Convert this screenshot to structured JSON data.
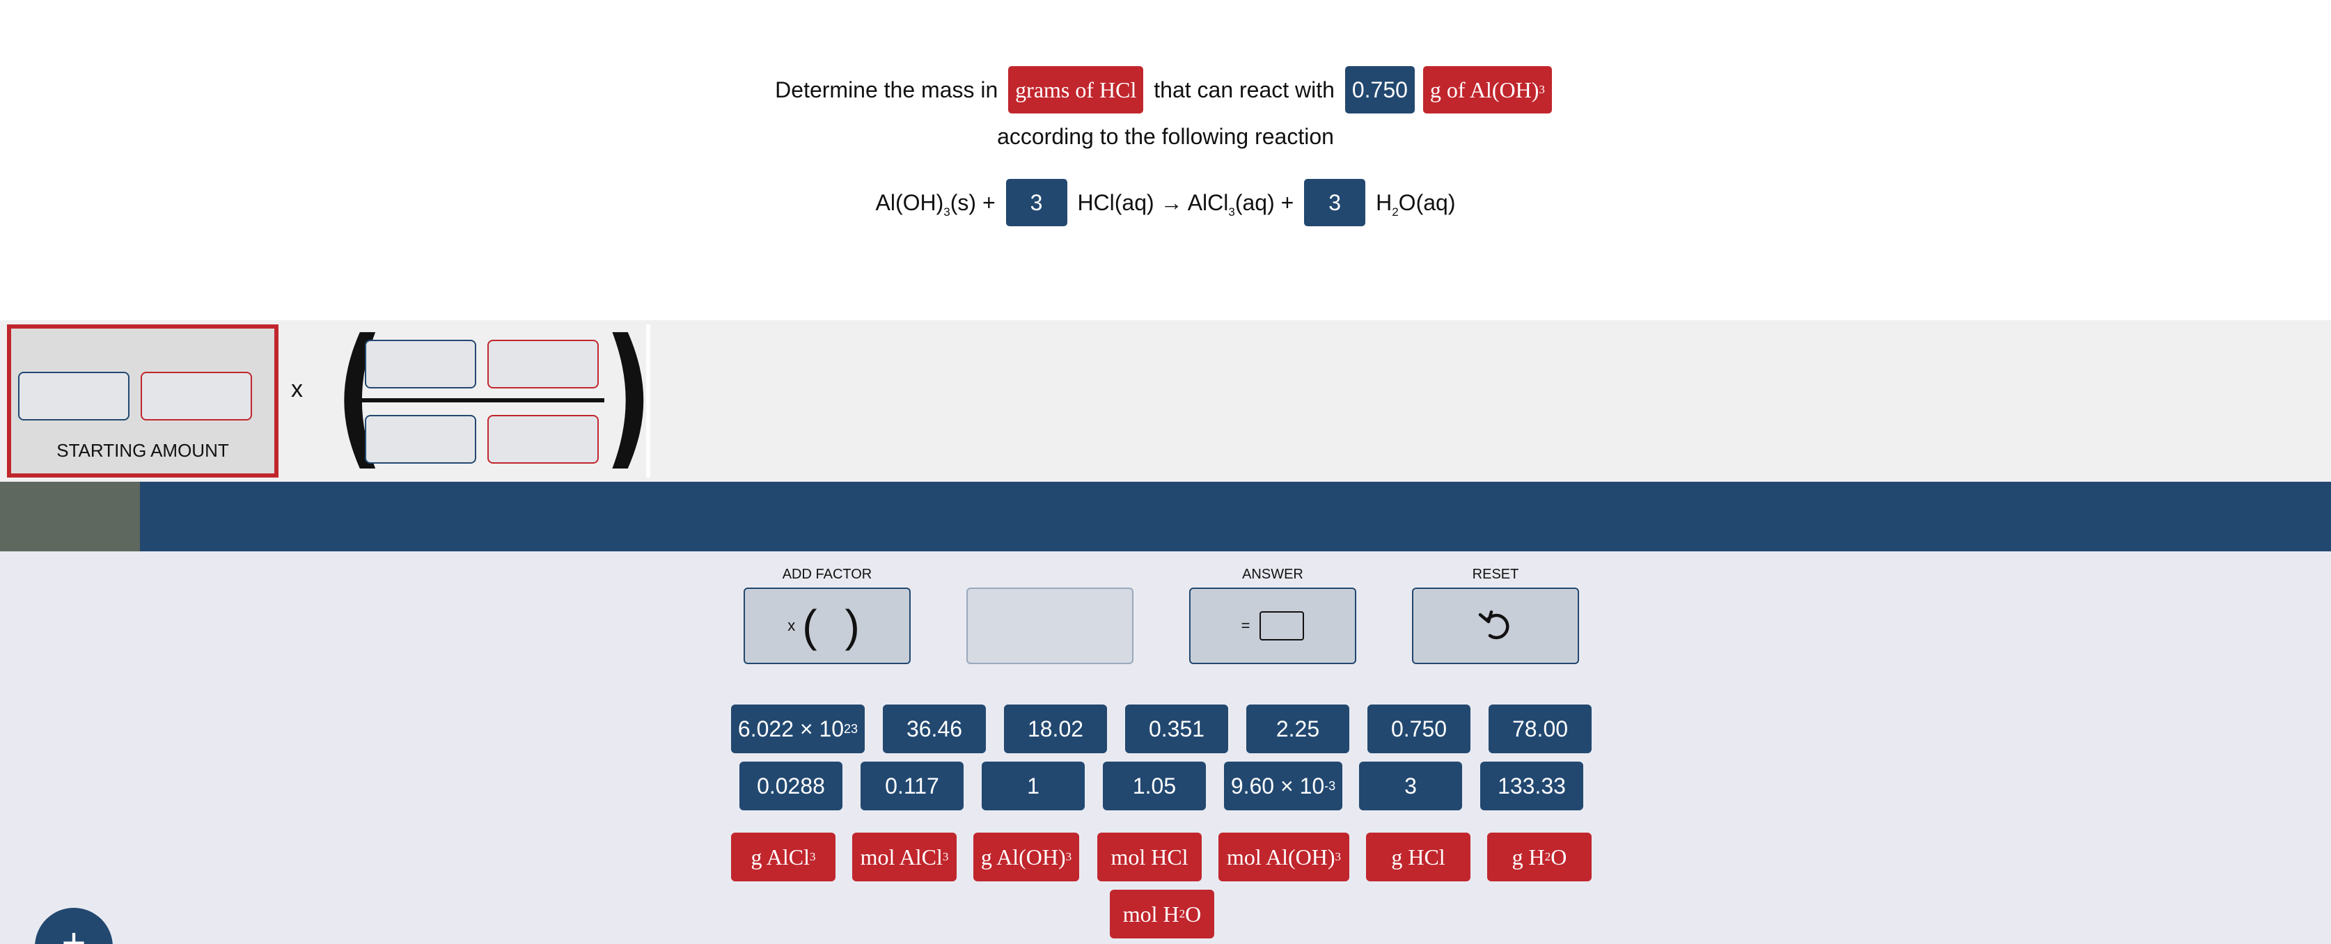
{
  "question": {
    "line1": {
      "prefix": "Determine the mass in ",
      "target_unit": "grams of HCl",
      "middle": " that can react with ",
      "given_value": "0.750",
      "given_unit_main": "g of Al(OH)",
      "given_unit_sub": "3"
    },
    "line2": "according to the following reaction",
    "reaction": {
      "r1_a": "Al(OH)",
      "r1_sub": "3",
      "r1_b": "(s) + ",
      "coef1": "3",
      "r2": " HCl(aq) → AlCl",
      "p1_sub": "3",
      "p1_b": "(aq) + ",
      "coef2": "3",
      "p2_a": " H",
      "p2_sub": "2",
      "p2_b": "O(aq)"
    }
  },
  "workspace": {
    "starting_amount_label": "STARTING AMOUNT",
    "times_symbol": "x",
    "left_paren": "(",
    "right_paren": ")"
  },
  "progress": {
    "fraction": 0.06
  },
  "controls": {
    "add_factor_label": "ADD FACTOR",
    "add_factor_x": "x",
    "add_factor_lparen": "(",
    "add_factor_rparen": ")",
    "answer_label": "ANSWER",
    "answer_equals": "=",
    "reset_label": "RESET",
    "reset_icon": "undo-arrow-icon"
  },
  "number_tiles": {
    "avogadro": {
      "base": "6.022 × 10",
      "exp": "23"
    },
    "row1": [
      "36.46",
      "18.02",
      "0.351",
      "2.25",
      "0.750",
      "78.00"
    ],
    "row2a": [
      "0.0288",
      "0.117",
      "1",
      "1.05"
    ],
    "sci": {
      "base": "9.60 × 10",
      "exp": "-3"
    },
    "row2b": [
      "3",
      "133.33"
    ]
  },
  "unit_tiles": {
    "g_alcl3": {
      "main": "g AlCl",
      "sub": "3"
    },
    "mol_alcl3": {
      "main": "mol AlCl",
      "sub": "3"
    },
    "g_aloh3": {
      "main": "g Al(OH)",
      "sub": "3"
    },
    "mol_hcl": {
      "main": "mol HCl"
    },
    "mol_aloh3": {
      "main": "mol Al(OH)",
      "sub": "3"
    },
    "g_hcl": {
      "main": "g HCl"
    },
    "g_h2o": {
      "a": "g H",
      "sub": "2",
      "b": "O"
    },
    "mol_h2o": {
      "a": "mol H",
      "sub": "2",
      "b": "O"
    }
  },
  "fab": {
    "symbol": "+"
  },
  "colors": {
    "navy": "#224870",
    "red": "#c1262d",
    "panel_bg": "#e9eaf1",
    "workspace_bg": "#f0f0f0",
    "progress_fill": "#5f685f"
  }
}
